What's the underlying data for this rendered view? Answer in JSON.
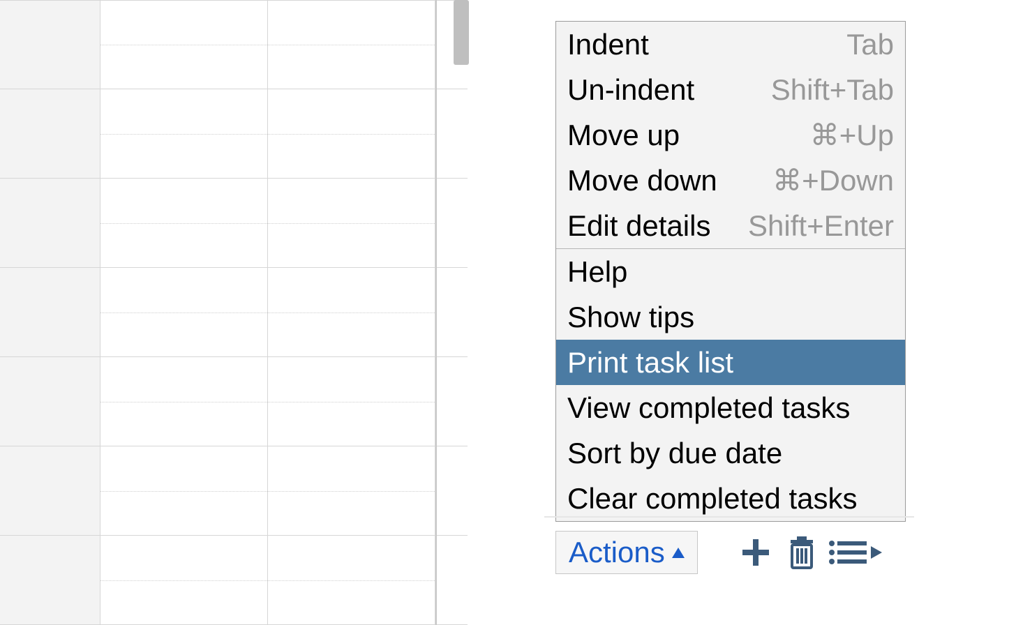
{
  "menu": {
    "items": [
      {
        "label": "Indent",
        "shortcut": "Tab",
        "highlighted": false
      },
      {
        "label": "Un-indent",
        "shortcut": "Shift+Tab",
        "highlighted": false
      },
      {
        "label": "Move up",
        "shortcut": "⌘+Up",
        "highlighted": false
      },
      {
        "label": "Move down",
        "shortcut": "⌘+Down",
        "highlighted": false
      },
      {
        "label": "Edit details",
        "shortcut": "Shift+Enter",
        "highlighted": false
      }
    ],
    "items2": [
      {
        "label": "Help",
        "shortcut": "",
        "highlighted": false
      },
      {
        "label": "Show tips",
        "shortcut": "",
        "highlighted": false
      },
      {
        "label": "Print task list",
        "shortcut": "",
        "highlighted": true
      },
      {
        "label": "View completed tasks",
        "shortcut": "",
        "highlighted": false
      },
      {
        "label": "Sort by due date",
        "shortcut": "",
        "highlighted": false
      },
      {
        "label": "Clear completed tasks",
        "shortcut": "",
        "highlighted": false
      }
    ]
  },
  "toolbar": {
    "actions_label": "Actions",
    "icons": {
      "plus": "plus-icon",
      "trash": "trash-icon",
      "list": "list-play-icon"
    }
  },
  "colors": {
    "menu_highlight": "#4b7ba3",
    "link_blue": "#1a5cc8",
    "icon_blue": "#3b5a7a"
  }
}
